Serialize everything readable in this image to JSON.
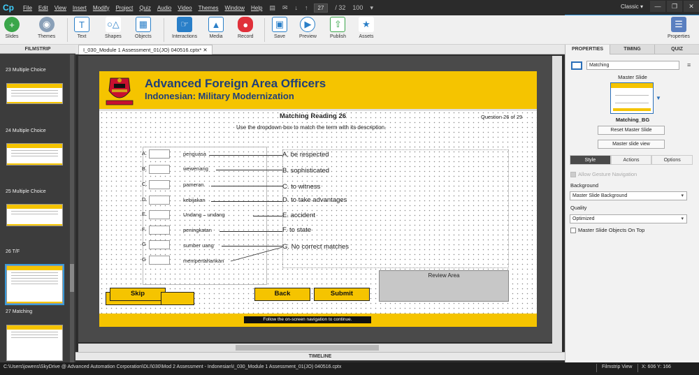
{
  "menubar": {
    "logo": "Cp",
    "items": [
      "File",
      "Edit",
      "View",
      "Insert",
      "Modify",
      "Project",
      "Quiz",
      "Audio",
      "Video",
      "Themes",
      "Window",
      "Help"
    ],
    "current_slide": "27",
    "total_slides": "/ 32",
    "zoom": "100",
    "workspace": "Classic"
  },
  "toolbar": {
    "slides": "Slides",
    "themes": "Themes",
    "text": "Text",
    "shapes": "Shapes",
    "objects": "Objects",
    "interactions": "Interactions",
    "media": "Media",
    "record": "Record",
    "save": "Save",
    "preview": "Preview",
    "publish": "Publish",
    "assets": "Assets",
    "properties": "Properties"
  },
  "filmstrip": {
    "header": "FILMSTRIP",
    "labels": [
      "23 Multiple Choice",
      "24 Multiple Choice",
      "25 Multiple Choice",
      "26 T/F",
      "27 Matching"
    ]
  },
  "document": {
    "tab": "I_030_Module 1 Assessment_01(JO) 040516.cptx*",
    "timeline": "TIMELINE"
  },
  "slide": {
    "title": "Advanced Foreign Area Officers",
    "subtitle": "Indonesian: Military Modernization",
    "heading": "Matching Reading 26",
    "question_num": "Question 26 of 29",
    "instruction": "Use the dropdown box to match the term with its description.",
    "letters": [
      "A.",
      "B.",
      "C.",
      "D.",
      "E.",
      "F.",
      "G",
      "G"
    ],
    "terms": [
      "penguasa",
      "wewenang",
      "pameran",
      "kebijakan",
      "Undang – undang",
      "peningkatan",
      "sumber uang",
      "mempertahankan"
    ],
    "definitions": [
      "A. be respected",
      "B. sophisticated",
      "C. to witness",
      "D. to take advantages",
      "E. accident",
      "F. to state",
      "G. No correct matches"
    ],
    "buttons": {
      "skip": "Skip",
      "back": "Back",
      "submit": "Submit"
    },
    "review": "Review Area",
    "footer": "Follow the on-screen navigation to continue.",
    "colors": {
      "gold": "#f5c400",
      "navy": "#1f3f7a"
    }
  },
  "properties": {
    "tabs": [
      "PROPERTIES",
      "TIMING",
      "QUIZ"
    ],
    "slide_name": "Matching",
    "master_label": "Master Slide",
    "master_name": "Matching_BG",
    "reset": "Reset Master Slide",
    "view": "Master slide view",
    "subtabs": [
      "Style",
      "Actions",
      "Options"
    ],
    "allow_gesture": "Allow Gesture Navigation",
    "background_label": "Background",
    "background_value": "Master Slide Background",
    "quality_label": "Quality",
    "quality_value": "Optimized",
    "objects_on_top": "Master Slide Objects On Top"
  },
  "status": {
    "path": "C:\\Users\\jowens\\SkyDrive @ Advanced Automation Corporation\\DLI\\030\\Mod 2 Assessment - Indonesian\\I_030_Module 1 Assessment_01(JO) 040516.cptx",
    "view": "Filmstrip View",
    "coords": "X: 606 Y: 166"
  }
}
